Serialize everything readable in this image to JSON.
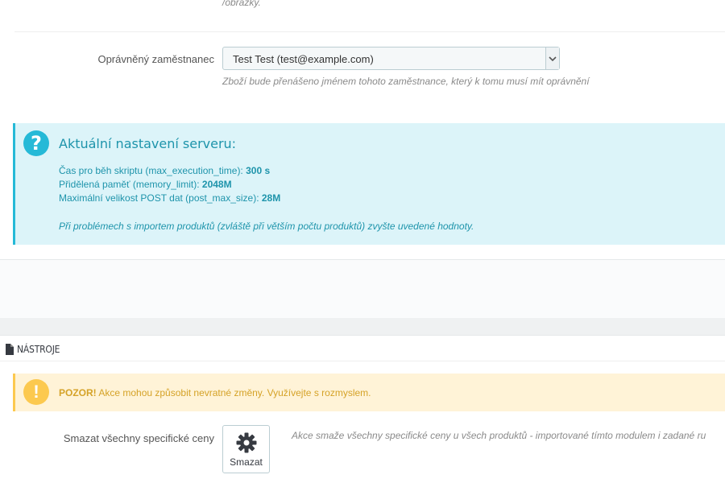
{
  "top": {
    "images_hint_tail": "/obrázky."
  },
  "employee": {
    "label": "Oprávněný zaměstnanec",
    "selected": "Test Test (test@example.com)",
    "hint": "Zboží bude přenášeno jménem tohoto zaměstnance, který k tomu musí mít oprávnění"
  },
  "server_info": {
    "icon": "question-icon",
    "title": "Aktuální nastavení serveru:",
    "lines": [
      {
        "label": "Čas pro běh skriptu (max_execution_time): ",
        "value": "300 s"
      },
      {
        "label": "Přidělená paměť (memory_limit): ",
        "value": "2048M"
      },
      {
        "label": "Maximální velikost POST dat (post_max_size): ",
        "value": "28M"
      }
    ],
    "note": "Při problémech s importem produktů (zvláště při větším počtu produktů) zvyšte uvedené hodnoty."
  },
  "tools": {
    "icon": "document-icon",
    "title": "NÁSTROJE",
    "warning": {
      "icon": "exclamation-icon",
      "strong": "POZOR!",
      "text": " Akce mohou způsobit nevratné změny. Využívejte s rozmyslem."
    },
    "delete_specific_prices": {
      "label": "Smazat všechny specifické ceny",
      "button_label": "Smazat",
      "button_icon": "gear-icon",
      "hint": "Akce smaže všechny specifické ceny u všech produktů - importované tímto modulem i zadané ru"
    }
  },
  "colors": {
    "info_accent": "#25b9d7",
    "info_text": "#1e94ab",
    "warning_accent": "#fcc94f",
    "warning_text": "#d5a227"
  }
}
